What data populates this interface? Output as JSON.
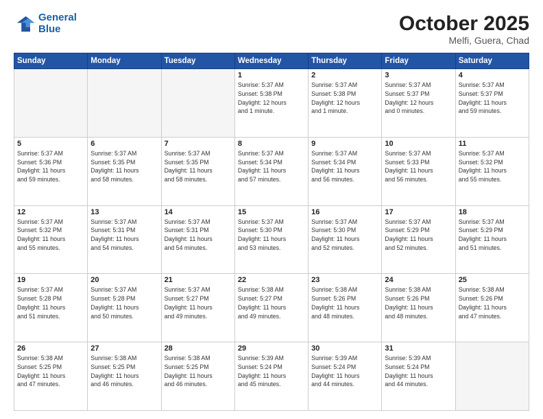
{
  "header": {
    "logo_line1": "General",
    "logo_line2": "Blue",
    "month": "October 2025",
    "location": "Melfi, Guera, Chad"
  },
  "weekdays": [
    "Sunday",
    "Monday",
    "Tuesday",
    "Wednesday",
    "Thursday",
    "Friday",
    "Saturday"
  ],
  "weeks": [
    [
      {
        "num": "",
        "info": ""
      },
      {
        "num": "",
        "info": ""
      },
      {
        "num": "",
        "info": ""
      },
      {
        "num": "1",
        "info": "Sunrise: 5:37 AM\nSunset: 5:38 PM\nDaylight: 12 hours\nand 1 minute."
      },
      {
        "num": "2",
        "info": "Sunrise: 5:37 AM\nSunset: 5:38 PM\nDaylight: 12 hours\nand 1 minute."
      },
      {
        "num": "3",
        "info": "Sunrise: 5:37 AM\nSunset: 5:37 PM\nDaylight: 12 hours\nand 0 minutes."
      },
      {
        "num": "4",
        "info": "Sunrise: 5:37 AM\nSunset: 5:37 PM\nDaylight: 11 hours\nand 59 minutes."
      }
    ],
    [
      {
        "num": "5",
        "info": "Sunrise: 5:37 AM\nSunset: 5:36 PM\nDaylight: 11 hours\nand 59 minutes."
      },
      {
        "num": "6",
        "info": "Sunrise: 5:37 AM\nSunset: 5:35 PM\nDaylight: 11 hours\nand 58 minutes."
      },
      {
        "num": "7",
        "info": "Sunrise: 5:37 AM\nSunset: 5:35 PM\nDaylight: 11 hours\nand 58 minutes."
      },
      {
        "num": "8",
        "info": "Sunrise: 5:37 AM\nSunset: 5:34 PM\nDaylight: 11 hours\nand 57 minutes."
      },
      {
        "num": "9",
        "info": "Sunrise: 5:37 AM\nSunset: 5:34 PM\nDaylight: 11 hours\nand 56 minutes."
      },
      {
        "num": "10",
        "info": "Sunrise: 5:37 AM\nSunset: 5:33 PM\nDaylight: 11 hours\nand 56 minutes."
      },
      {
        "num": "11",
        "info": "Sunrise: 5:37 AM\nSunset: 5:32 PM\nDaylight: 11 hours\nand 55 minutes."
      }
    ],
    [
      {
        "num": "12",
        "info": "Sunrise: 5:37 AM\nSunset: 5:32 PM\nDaylight: 11 hours\nand 55 minutes."
      },
      {
        "num": "13",
        "info": "Sunrise: 5:37 AM\nSunset: 5:31 PM\nDaylight: 11 hours\nand 54 minutes."
      },
      {
        "num": "14",
        "info": "Sunrise: 5:37 AM\nSunset: 5:31 PM\nDaylight: 11 hours\nand 54 minutes."
      },
      {
        "num": "15",
        "info": "Sunrise: 5:37 AM\nSunset: 5:30 PM\nDaylight: 11 hours\nand 53 minutes."
      },
      {
        "num": "16",
        "info": "Sunrise: 5:37 AM\nSunset: 5:30 PM\nDaylight: 11 hours\nand 52 minutes."
      },
      {
        "num": "17",
        "info": "Sunrise: 5:37 AM\nSunset: 5:29 PM\nDaylight: 11 hours\nand 52 minutes."
      },
      {
        "num": "18",
        "info": "Sunrise: 5:37 AM\nSunset: 5:29 PM\nDaylight: 11 hours\nand 51 minutes."
      }
    ],
    [
      {
        "num": "19",
        "info": "Sunrise: 5:37 AM\nSunset: 5:28 PM\nDaylight: 11 hours\nand 51 minutes."
      },
      {
        "num": "20",
        "info": "Sunrise: 5:37 AM\nSunset: 5:28 PM\nDaylight: 11 hours\nand 50 minutes."
      },
      {
        "num": "21",
        "info": "Sunrise: 5:37 AM\nSunset: 5:27 PM\nDaylight: 11 hours\nand 49 minutes."
      },
      {
        "num": "22",
        "info": "Sunrise: 5:38 AM\nSunset: 5:27 PM\nDaylight: 11 hours\nand 49 minutes."
      },
      {
        "num": "23",
        "info": "Sunrise: 5:38 AM\nSunset: 5:26 PM\nDaylight: 11 hours\nand 48 minutes."
      },
      {
        "num": "24",
        "info": "Sunrise: 5:38 AM\nSunset: 5:26 PM\nDaylight: 11 hours\nand 48 minutes."
      },
      {
        "num": "25",
        "info": "Sunrise: 5:38 AM\nSunset: 5:26 PM\nDaylight: 11 hours\nand 47 minutes."
      }
    ],
    [
      {
        "num": "26",
        "info": "Sunrise: 5:38 AM\nSunset: 5:25 PM\nDaylight: 11 hours\nand 47 minutes."
      },
      {
        "num": "27",
        "info": "Sunrise: 5:38 AM\nSunset: 5:25 PM\nDaylight: 11 hours\nand 46 minutes."
      },
      {
        "num": "28",
        "info": "Sunrise: 5:38 AM\nSunset: 5:25 PM\nDaylight: 11 hours\nand 46 minutes."
      },
      {
        "num": "29",
        "info": "Sunrise: 5:39 AM\nSunset: 5:24 PM\nDaylight: 11 hours\nand 45 minutes."
      },
      {
        "num": "30",
        "info": "Sunrise: 5:39 AM\nSunset: 5:24 PM\nDaylight: 11 hours\nand 44 minutes."
      },
      {
        "num": "31",
        "info": "Sunrise: 5:39 AM\nSunset: 5:24 PM\nDaylight: 11 hours\nand 44 minutes."
      },
      {
        "num": "",
        "info": ""
      }
    ]
  ]
}
